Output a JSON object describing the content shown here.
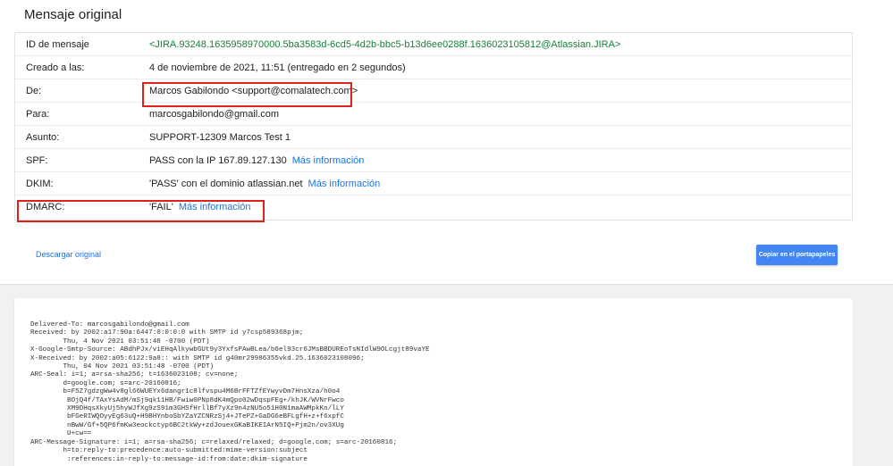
{
  "page_title": "Mensaje original",
  "headers": [
    {
      "label": "ID de mensaje",
      "value": "<JIRA.93248.1635958970000.5ba3583d-6cd5-4d2b-bbc5-b13d6ee0288f.1636023105812@Atlassian.JIRA>",
      "link": ""
    },
    {
      "label": "Creado a las:",
      "value": "4 de noviembre de 2021, 11:51 (entregado en 2 segundos)",
      "link": ""
    },
    {
      "label": "De:",
      "value": "Marcos Gabilondo <support@comalatech.com>",
      "link": ""
    },
    {
      "label": "Para:",
      "value": "marcosgabilondo@gmail.com",
      "link": ""
    },
    {
      "label": "Asunto:",
      "value": "SUPPORT-12309 Marcos Test 1",
      "link": ""
    },
    {
      "label": "SPF:",
      "value": "PASS con la IP 167.89.127.130",
      "link": "Más información"
    },
    {
      "label": "DKIM:",
      "value": "'PASS' con el dominio atlassian.net",
      "link": "Más información"
    },
    {
      "label": "DMARC:",
      "value": "'FAIL'",
      "link": "Más información"
    }
  ],
  "download_label": "Descargar original",
  "copy_label": "Copiar en el portapapeles",
  "raw_lines": [
    "Delivered-To: marcosgabilondo@gmail.com",
    "Received: by 2002:a17:90a:6447:0:0:0:0 with SMTP id y7csp589368pjm;",
    "        Thu, 4 Nov 2021 03:51:48 -0700 (PDT)",
    "X-Google-Smtp-Source: ABdhPJx/viEHqAlkywbGUt9y3YxfsPAwBLea/b6el93cr6JMsBBDUREoTsNIdlW9OLcgjt89vaYE",
    "X-Received: by 2002:a05:6122:9a8:: with SMTP id g40mr29986355vkd.25.1636023108096;",
    "        Thu, 04 Nov 2021 03:51:48 -0700 (PDT)",
    "ARC-Seal: i=1; a=rsa-sha256; t=1636023108; cv=none;",
    "        d=google.com; s=arc-20160816;",
    "        b=F5Z7gdzgWw4v8gl66WUEYx6dangr1c8lfvspu4M6BrFFTZfEYwyvDm7HnsXza/h0o4",
    "         BOjQ4f/TAxYsAdM/mSj9qk11HB/Fwiw0PNp8dK4mQpo02wDqspFEg+/khJK/WVNrFwco",
    "         XM9DHqsXkyUj5hyWJfXg9zS91m3GHSfHrllBf7yXz9n4zNU5o51H0N1maAWMpkKn/lLY",
    "         bFGeRIWQOyyEg63uQ+H9BHYnboSbYZaYZCNRzSj4+JTePZ+GaDG6eBFLgfH+z+f6xpfC",
    "         nBwW/Gf+5QP6fmKw3eockctyp6BC2tkWy+zdJouexGKaBIKEIArN5IQ+Pjm2n/ov3XUg",
    "         U+cw==",
    "ARC-Message-Signature: i=1; a=rsa-sha256; c=relaxed/relaxed; d=google.com; s=arc-20160816;",
    "        h=to:reply-to:precedence:auto-submitted:mime-version:subject",
    "         :references:in-reply-to:message-id:from:date:dkim-signature"
  ]
}
